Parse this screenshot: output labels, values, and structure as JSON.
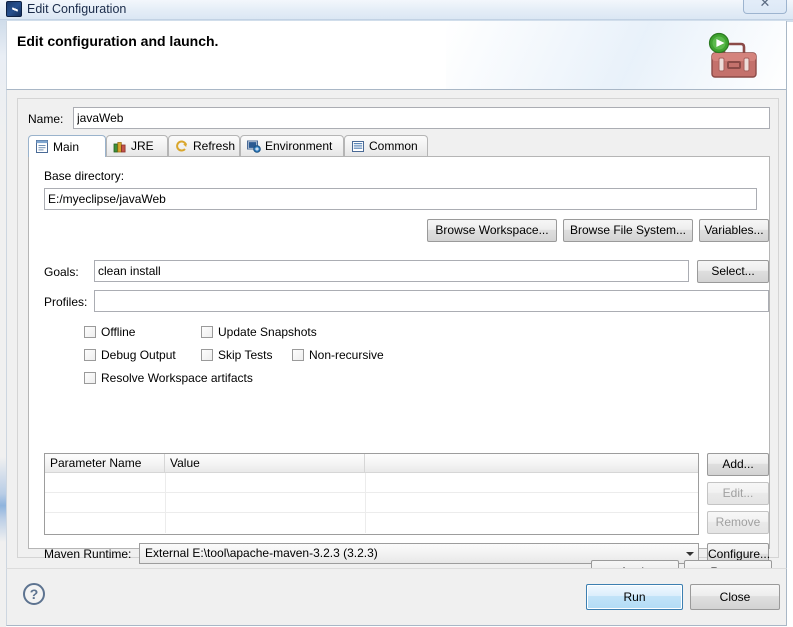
{
  "window": {
    "title": "Edit Configuration",
    "title_icon": "eclipse-launch-icon",
    "close_label": "✕"
  },
  "header": {
    "title": "Edit configuration and launch.",
    "icon": "maven-toolbox-run-icon"
  },
  "form": {
    "name_label": "Name:",
    "name_value": "javaWeb",
    "name_placeholder": ""
  },
  "tabs": [
    {
      "label": "Main",
      "icon": "document-icon",
      "active": true
    },
    {
      "label": "JRE",
      "icon": "jre-books-icon",
      "active": false
    },
    {
      "label": "Refresh",
      "icon": "refresh-arrows-icon",
      "active": false
    },
    {
      "label": "Environment",
      "icon": "environment-icon",
      "active": false
    },
    {
      "label": "Common",
      "icon": "common-list-icon",
      "active": false
    }
  ],
  "main_tab": {
    "base_directory_label": "Base directory:",
    "base_directory_value": "E:/myeclipse/javaWeb",
    "browse_workspace_label": "Browse Workspace...",
    "browse_filesystem_label": "Browse File System...",
    "variables_label": "Variables...",
    "goals_label": "Goals:",
    "goals_value": "clean install",
    "select_label": "Select...",
    "profiles_label": "Profiles:",
    "profiles_value": "",
    "checkboxes": [
      {
        "label": "Offline",
        "checked": false
      },
      {
        "label": "Update Snapshots",
        "checked": false
      },
      {
        "label": "Debug Output",
        "checked": false
      },
      {
        "label": "Skip Tests",
        "checked": false
      },
      {
        "label": "Non-recursive",
        "checked": false
      },
      {
        "label": "Resolve Workspace artifacts",
        "checked": false
      }
    ],
    "table": {
      "columns": [
        "Parameter Name",
        "Value",
        ""
      ],
      "rows": [],
      "empty_row_count": 3
    },
    "table_buttons": [
      {
        "label": "Add...",
        "enabled": true
      },
      {
        "label": "Edit...",
        "enabled": false
      },
      {
        "label": "Remove",
        "enabled": false
      }
    ],
    "maven_runtime_label": "Maven Runtime:",
    "maven_runtime_value": "External E:\\tool\\apache-maven-3.2.3 (3.2.3)",
    "configure_label": "Configure..."
  },
  "actions": {
    "apply_label": "Apply",
    "revert_label": "Revert"
  },
  "footer": {
    "help_label": "?",
    "run_label": "Run",
    "close_label": "Close"
  },
  "colors": {
    "dialog_bg": "#f0f0f0",
    "field_bg": "#ffffff",
    "field_border": "#abadb3",
    "primary_button_border": "#3c7fb1",
    "title_text": "#1b2c4a"
  }
}
